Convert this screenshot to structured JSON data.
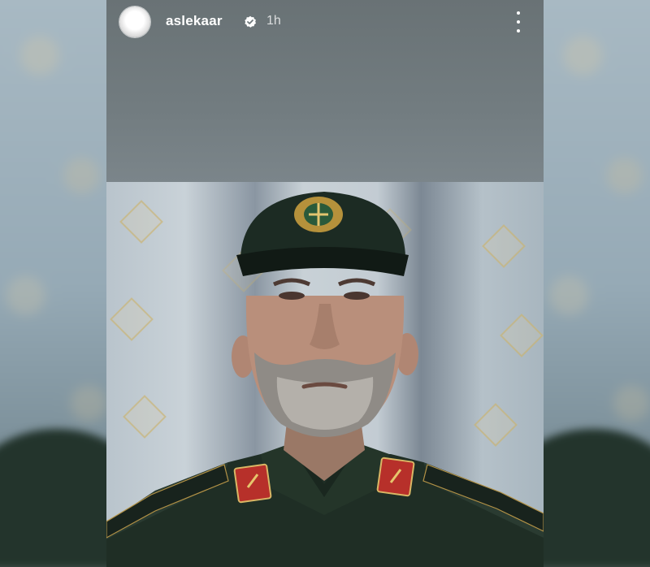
{
  "story": {
    "username": "aslekaar",
    "time": "1h",
    "verified": true
  },
  "icons": {
    "avatar": "profile-avatar",
    "verified": "verified-badge-icon",
    "more": "more-options-icon"
  },
  "photo": {
    "subject": "portrait-photo"
  }
}
